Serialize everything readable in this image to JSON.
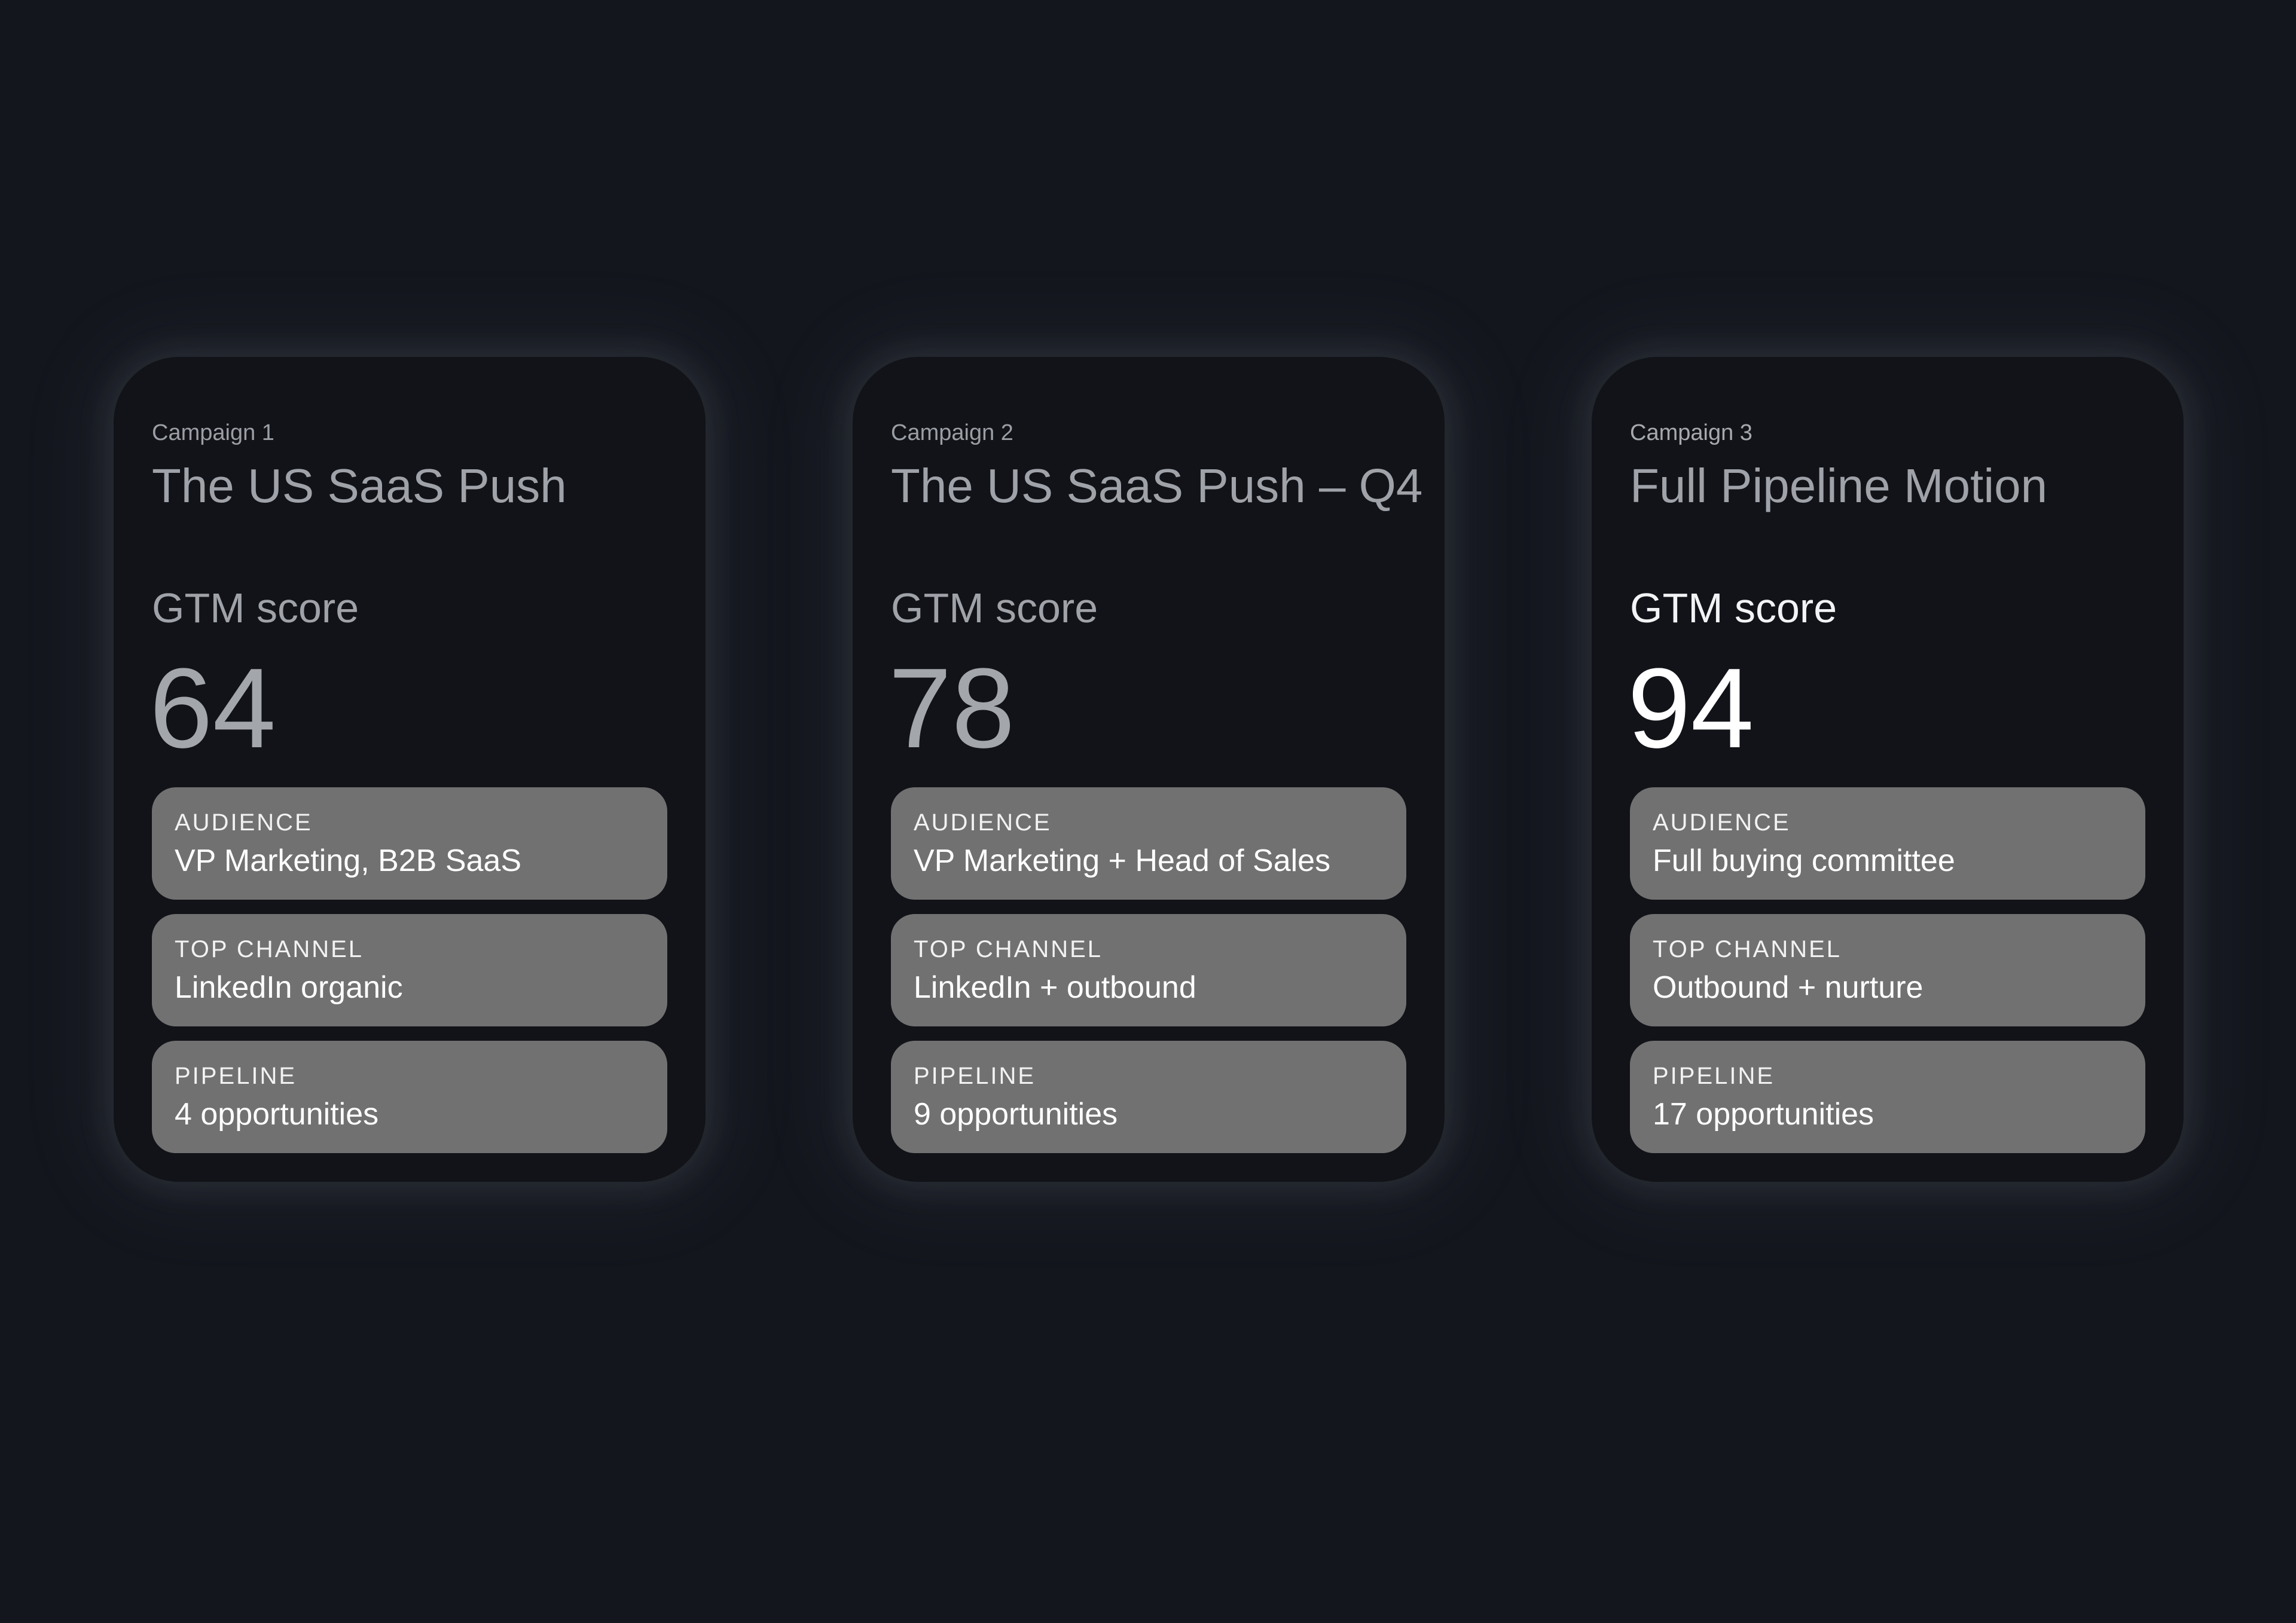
{
  "cards": [
    {
      "campaign_label": "Campaign 1",
      "title": "The US SaaS Push",
      "score_label": "GTM score",
      "score": "64",
      "metrics": {
        "audience": {
          "label": "AUDIENCE",
          "value": "VP Marketing, B2B SaaS"
        },
        "top_channel": {
          "label": "TOP CHANNEL",
          "value": "LinkedIn organic"
        },
        "pipeline": {
          "label": "PIPELINE",
          "value": "4 opportunities"
        }
      }
    },
    {
      "campaign_label": "Campaign 2",
      "title": "The US SaaS Push – Q4",
      "score_label": "GTM score",
      "score": "78",
      "metrics": {
        "audience": {
          "label": "AUDIENCE",
          "value": "VP Marketing + Head of Sales"
        },
        "top_channel": {
          "label": "TOP CHANNEL",
          "value": "LinkedIn + outbound"
        },
        "pipeline": {
          "label": "PIPELINE",
          "value": "9 opportunities"
        }
      }
    },
    {
      "campaign_label": "Campaign 3",
      "title": "Full Pipeline Motion",
      "score_label": "GTM score",
      "score": "94",
      "metrics": {
        "audience": {
          "label": "AUDIENCE",
          "value": "Full buying committee"
        },
        "top_channel": {
          "label": "TOP CHANNEL",
          "value": "Outbound + nurture"
        },
        "pipeline": {
          "label": "PIPELINE",
          "value": "17 opportunities"
        }
      }
    }
  ],
  "colors": {
    "page_background": "#13161d",
    "card_background": "#111318",
    "metric_background": "#717171",
    "muted_text": "#9fa2a8",
    "highlight_text": "#ffffff"
  }
}
